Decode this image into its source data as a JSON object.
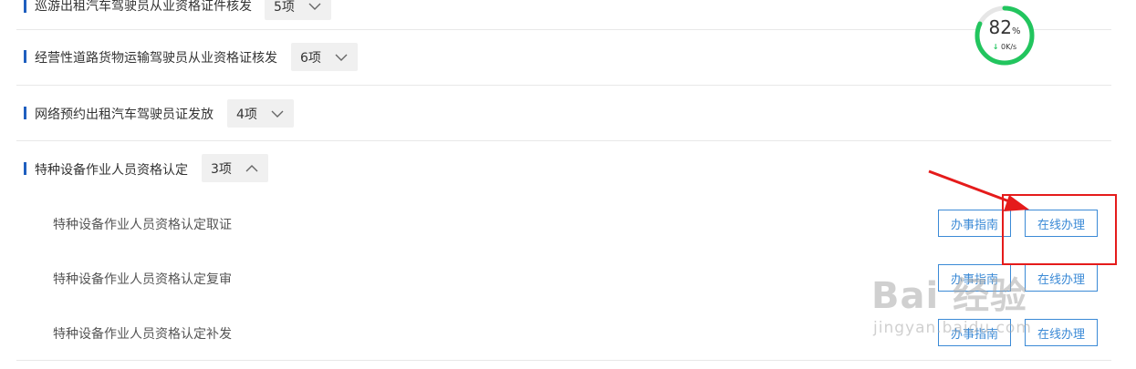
{
  "categories": [
    {
      "title": "巡游出租汽车驾驶员从业资格证件核发",
      "count": "5项",
      "expanded": false
    },
    {
      "title": "经营性道路货物运输驾驶员从业资格证核发",
      "count": "6项",
      "expanded": false
    },
    {
      "title": "网络预约出租汽车驾驶员证发放",
      "count": "4项",
      "expanded": false
    },
    {
      "title": "特种设备作业人员资格认定",
      "count": "3项",
      "expanded": true
    }
  ],
  "sub_items": [
    {
      "label": "特种设备作业人员资格认定取证",
      "guide_label": "办事指南",
      "online_label": "在线办理"
    },
    {
      "label": "特种设备作业人员资格认定复审",
      "guide_label": "办事指南",
      "online_label": "在线办理"
    },
    {
      "label": "特种设备作业人员资格认定补发",
      "guide_label": "办事指南",
      "online_label": "在线办理"
    }
  ],
  "speed_widget": {
    "percent_value": "82",
    "percent_sign": "%",
    "speed": "0K/s",
    "progress": 0.82
  },
  "watermark": {
    "main": "Bai 经验",
    "sub": "jingyan.baidu.com"
  },
  "colors": {
    "accent": "#1f5fbf",
    "button": "#3b8ad6",
    "annotation": "#e51b1b",
    "ring": "#22c55e"
  }
}
